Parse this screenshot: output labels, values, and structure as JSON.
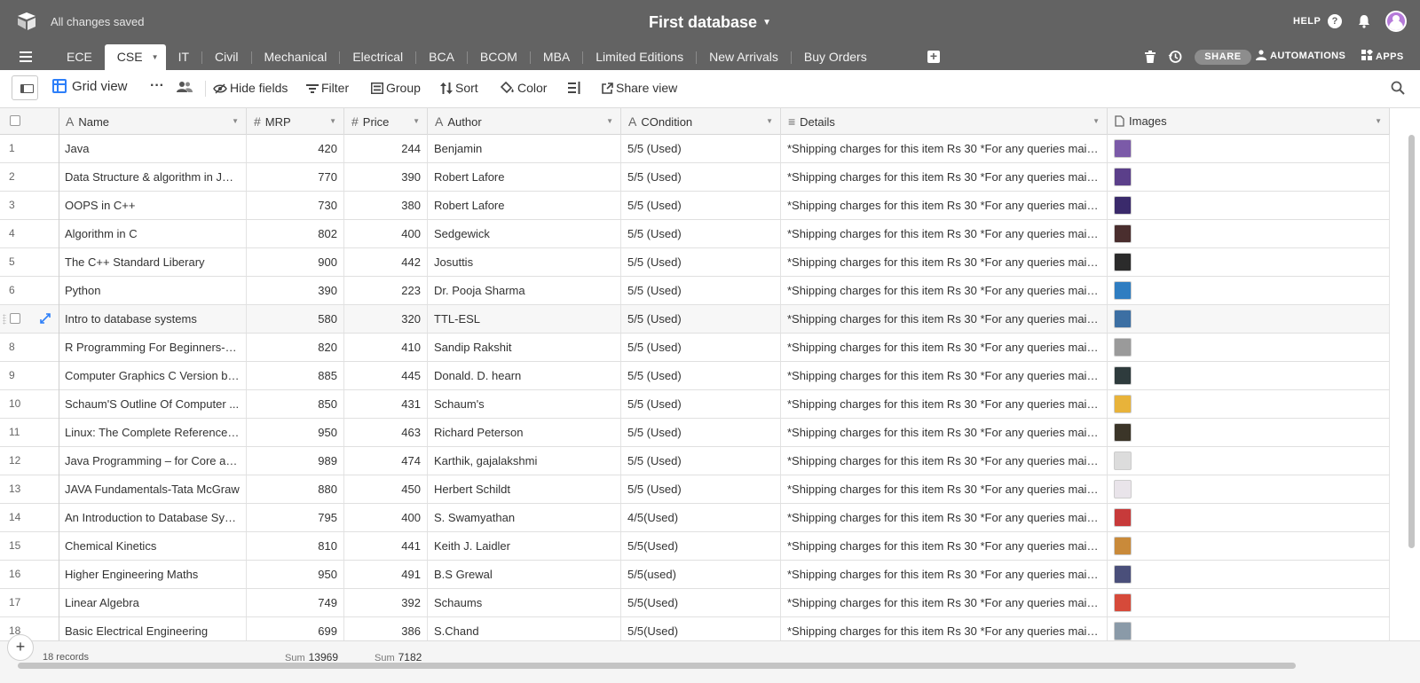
{
  "topbar": {
    "status": "All changes saved",
    "title": "First database",
    "help_label": "HELP",
    "help_icon": "?"
  },
  "tabs": [
    {
      "label": "ECE"
    },
    {
      "label": "CSE"
    },
    {
      "label": "IT"
    },
    {
      "label": "Civil"
    },
    {
      "label": "Mechanical"
    },
    {
      "label": "Electrical"
    },
    {
      "label": "BCA"
    },
    {
      "label": "BCOM"
    },
    {
      "label": "MBA"
    },
    {
      "label": "Limited Editions"
    },
    {
      "label": "New Arrivals"
    },
    {
      "label": "Buy Orders"
    }
  ],
  "active_tab": "CSE",
  "tabbar_right": {
    "share": "SHARE",
    "automations": "AUTOMATIONS",
    "apps": "APPS"
  },
  "viewbar": {
    "view_name": "Grid view",
    "hide_fields": "Hide fields",
    "filter": "Filter",
    "group": "Group",
    "sort": "Sort",
    "color": "Color",
    "share_view": "Share view"
  },
  "columns": [
    {
      "label": "Name",
      "icon": "A"
    },
    {
      "label": "MRP",
      "icon": "#"
    },
    {
      "label": "Price",
      "icon": "#"
    },
    {
      "label": "Author",
      "icon": "A"
    },
    {
      "label": "COndition",
      "icon": "A"
    },
    {
      "label": "Details",
      "icon": "≡"
    },
    {
      "label": "Images",
      "icon": "attachment"
    }
  ],
  "details_text": "*Shipping charges for this item Rs 30 *For any queries mail ...",
  "rows": [
    {
      "n": "1",
      "name": "Java",
      "mrp": "420",
      "price": "244",
      "author": "Benjamin",
      "condition": "5/5 (Used)",
      "thumb": "#7b5aa8"
    },
    {
      "n": "2",
      "name": "Data Structure & algorithm in Java",
      "mrp": "770",
      "price": "390",
      "author": "Robert Lafore",
      "condition": "5/5 (Used)",
      "thumb": "#5b3f8a"
    },
    {
      "n": "3",
      "name": "OOPS in C++",
      "mrp": "730",
      "price": "380",
      "author": "Robert Lafore",
      "condition": "5/5 (Used)",
      "thumb": "#3a2a6b"
    },
    {
      "n": "4",
      "name": "Algorithm in C",
      "mrp": "802",
      "price": "400",
      "author": "Sedgewick",
      "condition": "5/5 (Used)",
      "thumb": "#4a2e2e"
    },
    {
      "n": "5",
      "name": "The C++ Standard Liberary",
      "mrp": "900",
      "price": "442",
      "author": "Josuttis",
      "condition": "5/5 (Used)",
      "thumb": "#2b2b2b"
    },
    {
      "n": "6",
      "name": "Python",
      "mrp": "390",
      "price": "223",
      "author": "Dr. Pooja Sharma",
      "condition": "5/5 (Used)",
      "thumb": "#2f7dc1"
    },
    {
      "n": "7",
      "name": "Intro to database systems",
      "mrp": "580",
      "price": "320",
      "author": "TTL-ESL",
      "condition": "5/5 (Used)",
      "thumb": "#3c6fa3"
    },
    {
      "n": "8",
      "name": "R Programming For Beginners-Ta...",
      "mrp": "820",
      "price": "410",
      "author": "Sandip Rakshit",
      "condition": "5/5 (Used)",
      "thumb": "#9a9a9a"
    },
    {
      "n": "9",
      "name": "Computer Graphics C Version by ...",
      "mrp": "885",
      "price": "445",
      "author": "Donald. D. hearn",
      "condition": "5/5 (Used)",
      "thumb": "#2e3b3d"
    },
    {
      "n": "10",
      "name": "Schaum'S Outline Of Computer ...",
      "mrp": "850",
      "price": "431",
      "author": "Schaum's",
      "condition": "5/5 (Used)",
      "thumb": "#e8b33a"
    },
    {
      "n": "11",
      "name": "Linux: The Complete Reference-T...",
      "mrp": "950",
      "price": "463",
      "author": "Richard Peterson",
      "condition": "5/5 (Used)",
      "thumb": "#3b3528"
    },
    {
      "n": "12",
      "name": "Java Programming – for Core an...",
      "mrp": "989",
      "price": "474",
      "author": "Karthik, gajalakshmi",
      "condition": "5/5 (Used)",
      "thumb": "#dcdcdc"
    },
    {
      "n": "13",
      "name": "JAVA Fundamentals-Tata McGraw",
      "mrp": "880",
      "price": "450",
      "author": "Herbert Schildt",
      "condition": "5/5 (Used)",
      "thumb": "#e9e4ea"
    },
    {
      "n": "14",
      "name": "An Introduction to Database Syst...",
      "mrp": "795",
      "price": "400",
      "author": "S. Swamyathan",
      "condition": "4/5(Used)",
      "thumb": "#c73a3a"
    },
    {
      "n": "15",
      "name": "Chemical Kinetics",
      "mrp": "810",
      "price": "441",
      "author": "Keith J. Laidler",
      "condition": "5/5(Used)",
      "thumb": "#c98a3a"
    },
    {
      "n": "16",
      "name": "Higher Engineering Maths",
      "mrp": "950",
      "price": "491",
      "author": "B.S Grewal",
      "condition": "5/5(used)",
      "thumb": "#4a4f7a"
    },
    {
      "n": "17",
      "name": "Linear Algebra",
      "mrp": "749",
      "price": "392",
      "author": "Schaums",
      "condition": "5/5(Used)",
      "thumb": "#d64a3a"
    },
    {
      "n": "18",
      "name": "Basic Electrical Engineering",
      "mrp": "699",
      "price": "386",
      "author": "S.Chand",
      "condition": "5/5(Used)",
      "thumb": "#8a9aa8"
    }
  ],
  "footer": {
    "records": "18 records",
    "sum_label": "Sum",
    "mrp_sum": "13969",
    "price_sum": "7182"
  },
  "colors": {
    "topbar": "#636363",
    "accent": "#2d7ff9",
    "avatar": "#b57ad9"
  }
}
